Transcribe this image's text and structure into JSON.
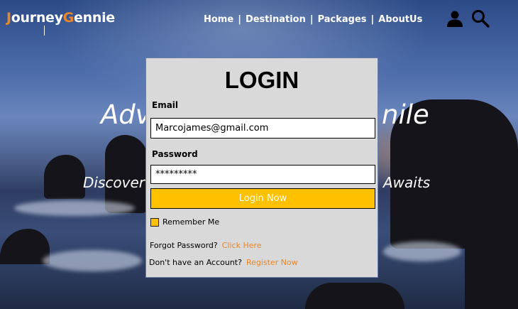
{
  "brand": {
    "part1": "J",
    "part2": "ourney",
    "part3": "G",
    "part4": "ennie"
  },
  "nav": {
    "items": [
      "Home",
      "Destination",
      "Packages",
      "AboutUs"
    ],
    "separator": "|"
  },
  "icons": {
    "user": "user-icon",
    "search": "search-icon"
  },
  "hero": {
    "title_left": "Adv",
    "title_right": "nile",
    "subtitle_left": "Discover",
    "subtitle_right": "Awaits"
  },
  "login": {
    "heading": "LOGIN",
    "email_label": "Email",
    "email_value": "Marcojames@gmail.com",
    "password_label": "Password",
    "password_value": "*********",
    "button_label": "Login Now",
    "remember_label": "Remember Me",
    "forgot_text": "Forgot Password?",
    "forgot_link": "Click Here",
    "account_text": "Don't have an Account?",
    "register_link": "Register Now"
  },
  "colors": {
    "accent": "#e8862a",
    "button": "#ffc000",
    "panel": "#d9d9d9"
  }
}
